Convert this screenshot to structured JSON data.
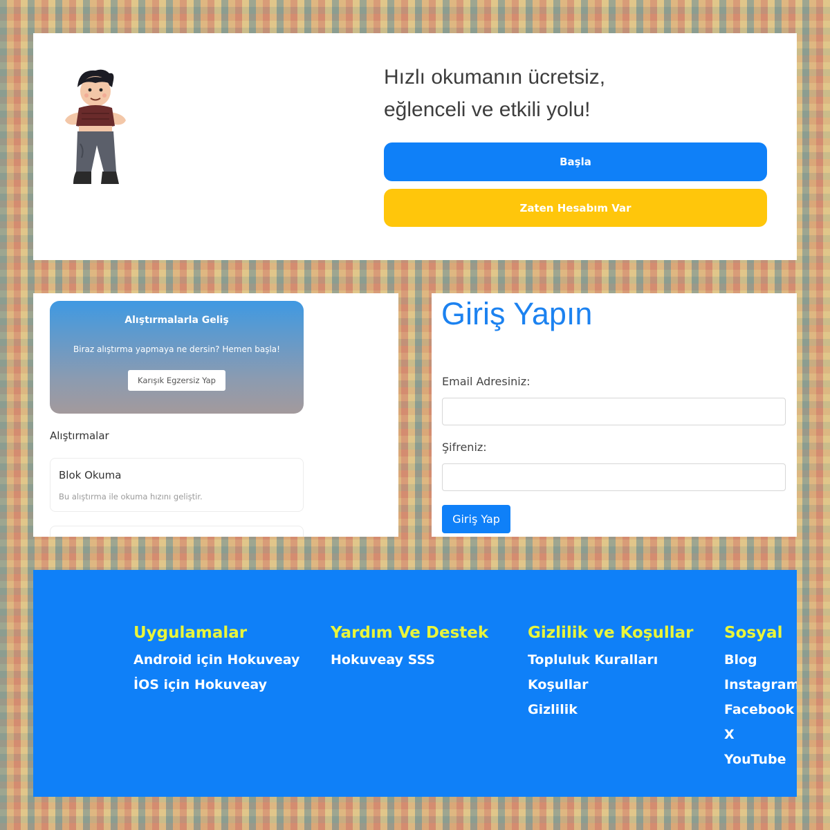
{
  "hero": {
    "illustration_icon": "cartoon-boy-icon",
    "title_line1": "Hızlı okumanın ücretsiz,",
    "title_line2": "eğlenceli ve etkili yolu!",
    "start_label": "Başla",
    "have_account_label": "Zaten Hesabım Var"
  },
  "exercises": {
    "promo_title": "Alıştırmalarla Geliş",
    "promo_text": "Biraz alıştırma yapmaya ne dersin? Hemen başla!",
    "promo_button": "Karışık Egzersiz Yap",
    "heading": "Alıştırmalar",
    "items": [
      {
        "title": "Blok Okuma",
        "description": "Bu alıştırma ile okuma hızını geliştir."
      }
    ]
  },
  "login": {
    "title": "Giriş Yapın",
    "email_label": "Email Adresiniz:",
    "email_value": "",
    "password_label": "Şifreniz:",
    "password_value": "",
    "submit_label": "Giriş Yap"
  },
  "footer": {
    "columns": [
      {
        "title": "Uygulamalar",
        "links": [
          "Android için Hokuveay",
          "İOS için Hokuveay"
        ]
      },
      {
        "title": "Yardım Ve Destek",
        "links": [
          "Hokuveay SSS"
        ]
      },
      {
        "title": "Gizlilik ve Koşullar",
        "links": [
          "Topluluk Kuralları",
          "Koşullar",
          "Gizlilik"
        ]
      },
      {
        "title": "Sosyal",
        "links": [
          "Blog",
          "Instagram",
          "Facebook",
          "X",
          "YouTube"
        ]
      }
    ]
  },
  "colors": {
    "primary_blue": "#0f80f8",
    "accent_yellow": "#ffc60b",
    "footer_heading": "#e9f53b"
  }
}
